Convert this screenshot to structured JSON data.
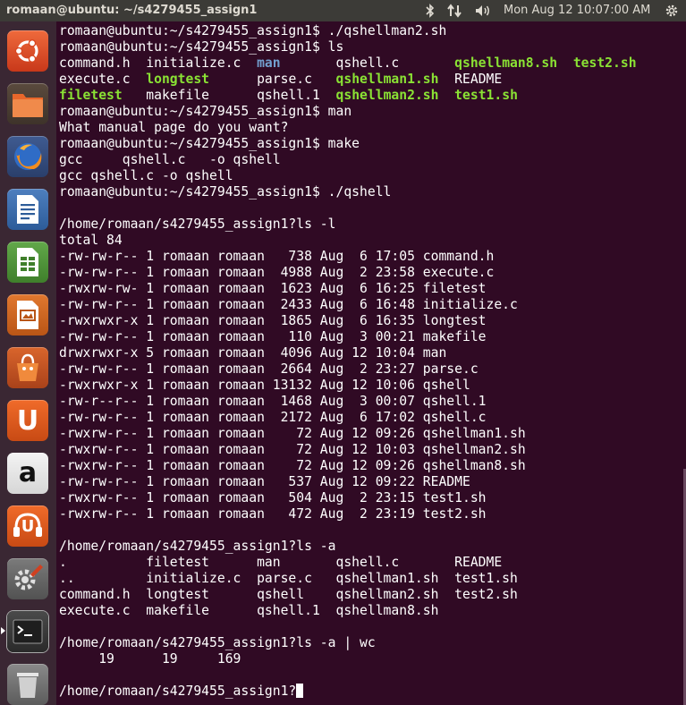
{
  "panel": {
    "window_title": "romaan@ubuntu: ~/s4279455_assign1",
    "clock": "Mon Aug 12  10:07:00 AM",
    "indicators": [
      "bluetooth-icon",
      "network-icon",
      "volume-icon",
      "settings-gear-icon"
    ]
  },
  "launcher": {
    "items": [
      "ubuntu-dash-icon",
      "files-icon",
      "firefox-icon",
      "writer-icon",
      "calc-icon",
      "impress-icon",
      "software-center-icon",
      "ubuntu-one-icon",
      "amazon-icon",
      "ubuntu-one-music-icon",
      "system-settings-icon",
      "terminal-icon",
      "trash-icon"
    ],
    "letters": {
      "ubuntu_one": "U",
      "amazon": "a",
      "music": "U"
    }
  },
  "terminal": {
    "lines": [
      "romaan@ubuntu:~/s4279455_assign1$ ./qshellman2.sh",
      "romaan@ubuntu:~/s4279455_assign1$ ls",
      "",
      "",
      "",
      "romaan@ubuntu:~/s4279455_assign1$ man",
      "What manual page do you want?",
      "romaan@ubuntu:~/s4279455_assign1$ make",
      "gcc     qshell.c   -o qshell",
      "gcc qshell.c -o qshell",
      "romaan@ubuntu:~/s4279455_assign1$ ./qshell",
      "",
      "/home/romaan/s4279455_assign1?ls -l",
      "total 84",
      "-rw-rw-r-- 1 romaan romaan   738 Aug  6 17:05 command.h",
      "-rw-rw-r-- 1 romaan romaan  4988 Aug  2 23:58 execute.c",
      "-rwxrw-rw- 1 romaan romaan  1623 Aug  6 16:25 filetest",
      "-rw-rw-r-- 1 romaan romaan  2433 Aug  6 16:48 initialize.c",
      "-rwxrwxr-x 1 romaan romaan  1865 Aug  6 16:35 longtest",
      "-rw-rw-r-- 1 romaan romaan   110 Aug  3 00:21 makefile",
      "drwxrwxr-x 5 romaan romaan  4096 Aug 12 10:04 man",
      "-rw-rw-r-- 1 romaan romaan  2664 Aug  2 23:27 parse.c",
      "-rwxrwxr-x 1 romaan romaan 13132 Aug 12 10:06 qshell",
      "-rw-r--r-- 1 romaan romaan  1468 Aug  3 00:07 qshell.1",
      "-rw-rw-r-- 1 romaan romaan  2172 Aug  6 17:02 qshell.c",
      "-rwxrw-r-- 1 romaan romaan    72 Aug 12 09:26 qshellman1.sh",
      "-rwxrw-r-- 1 romaan romaan    72 Aug 12 10:03 qshellman2.sh",
      "-rwxrw-r-- 1 romaan romaan    72 Aug 12 09:26 qshellman8.sh",
      "-rw-rw-r-- 1 romaan romaan   537 Aug 12 09:22 README",
      "-rwxrw-r-- 1 romaan romaan   504 Aug  2 23:15 test1.sh",
      "-rwxrw-r-- 1 romaan romaan   472 Aug  2 23:19 test2.sh",
      "",
      "/home/romaan/s4279455_assign1?ls -a",
      ".          filetest      man       qshell.c       README",
      "..         initialize.c  parse.c   qshellman1.sh  test1.sh",
      "command.h  longtest      qshell    qshellman2.sh  test2.sh",
      "execute.c  makefile      qshell.1  qshellman8.sh",
      "",
      "/home/romaan/s4279455_assign1?ls -a | wc",
      "     19      19     169",
      "",
      "/home/romaan/s4279455_assign1?"
    ],
    "ls_output": [
      [
        "command.h  initialize.c  ",
        {
          "t": "man",
          "c": "blue"
        },
        "       qshell.c       ",
        {
          "t": "qshellman8.sh",
          "c": "green"
        },
        "  ",
        {
          "t": "test2.sh",
          "c": "green"
        }
      ],
      [
        "execute.c  ",
        {
          "t": "longtest",
          "c": "green"
        },
        "      parse.c   ",
        {
          "t": "qshellman1.sh",
          "c": "green"
        },
        "  README"
      ],
      [
        {
          "t": "filetest",
          "c": "green"
        },
        "   makefile      qshell.1  ",
        {
          "t": "qshellman2.sh",
          "c": "green"
        },
        "  ",
        {
          "t": "test1.sh",
          "c": "green"
        }
      ]
    ],
    "ls_output_line_index": 2
  }
}
